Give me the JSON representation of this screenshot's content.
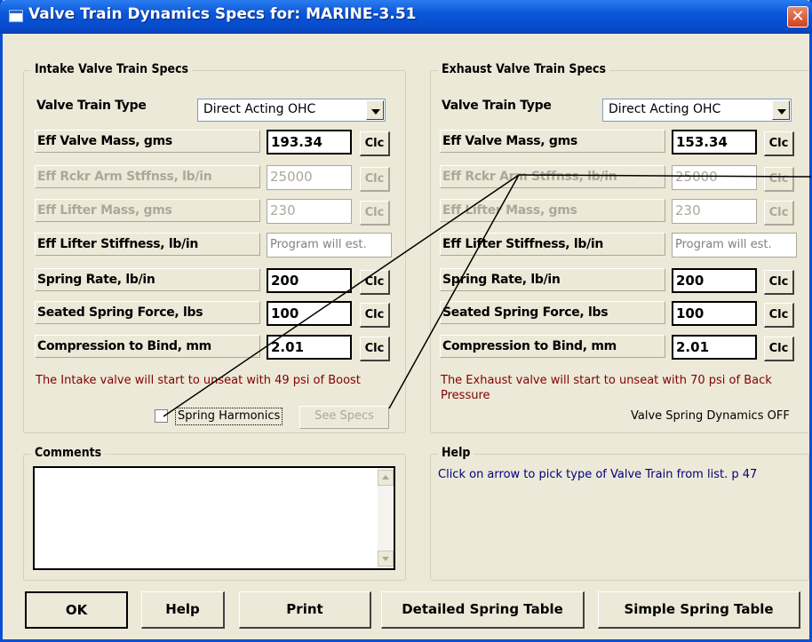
{
  "window": {
    "title": "Valve Train Dynamics Specs for: MARINE-3.51",
    "close_label": "✕"
  },
  "intake": {
    "group_title": "Intake Valve Train Specs",
    "valve_train_type_label": "Valve Train Type",
    "valve_train_type_value": "Direct Acting OHC",
    "eff_valve_mass_label": "Eff Valve Mass, gms",
    "eff_valve_mass_value": "193.34",
    "rckr_arm_label": "Eff Rckr Arm Stffnss, lb/in",
    "rckr_arm_value": "25000",
    "lifter_mass_label": "Eff Lifter Mass, gms",
    "lifter_mass_value": "230",
    "lifter_stiffness_label": "Eff Lifter Stiffness, lb/in",
    "lifter_stiffness_placeholder": "Program will est.",
    "spring_rate_label": "Spring Rate, lb/in",
    "spring_rate_value": "200",
    "seated_force_label": "Seated Spring Force, lbs",
    "seated_force_value": "100",
    "compression_label": "Compression to Bind, mm",
    "compression_value": "2.01",
    "note": "The Intake valve will start to unseat with 49 psi of Boost",
    "spring_harmonics_label": "Spring Harmonics",
    "see_specs_label": "See Specs"
  },
  "exhaust": {
    "group_title": "Exhaust Valve Train Specs",
    "valve_train_type_label": "Valve Train Type",
    "valve_train_type_value": "Direct Acting OHC",
    "eff_valve_mass_label": "Eff Valve Mass, gms",
    "eff_valve_mass_value": "153.34",
    "rckr_arm_label": "Eff Rckr Arm Stffnss, lb/in",
    "rckr_arm_value": "25000",
    "lifter_mass_label": "Eff Lifter Mass, gms",
    "lifter_mass_value": "230",
    "lifter_stiffness_label": "Eff Lifter Stiffness, lb/in",
    "lifter_stiffness_placeholder": "Program will est.",
    "spring_rate_label": "Spring Rate, lb/in",
    "spring_rate_value": "200",
    "seated_force_label": "Seated Spring Force, lbs",
    "seated_force_value": "100",
    "compression_label": "Compression to Bind, mm",
    "compression_value": "2.01",
    "note": "The Exhaust valve will start to unseat with 70 psi of Back Pressure",
    "status": "Valve Spring Dynamics OFF"
  },
  "clc_label": "Clc",
  "comments": {
    "group_title": "Comments"
  },
  "help": {
    "group_title": "Help",
    "text": "Click on arrow to pick type of Valve Train from list.  p 47"
  },
  "buttons": {
    "ok": "OK",
    "help": "Help",
    "print": "Print",
    "detailed": "Detailed Spring Table",
    "simple": "Simple Spring Table"
  },
  "colors": {
    "title_bar": "#0a57d9",
    "note_text": "#800000",
    "help_text": "#000080",
    "disabled_text": "#aca899"
  }
}
